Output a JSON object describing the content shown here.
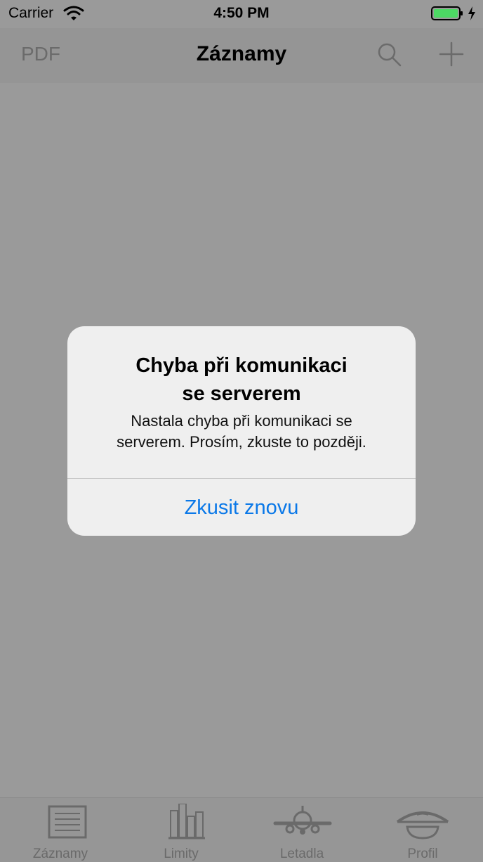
{
  "status_bar": {
    "carrier": "Carrier",
    "time": "4:50 PM",
    "icons": [
      "wifi-icon",
      "battery-icon",
      "charging-bolt-icon"
    ]
  },
  "nav": {
    "left_label": "PDF",
    "title": "Záznamy",
    "right_icons": [
      "search-icon",
      "plus-icon"
    ]
  },
  "alert": {
    "title_line1": "Chyba při komunikaci",
    "title_line2": "se serverem",
    "message_line1": "Nastala chyba při komunikaci se",
    "message_line2": "serverem. Prosím, zkuste to později.",
    "button_label": "Zkusit znovu"
  },
  "tab_bar": {
    "items": [
      {
        "label": "Záznamy",
        "icon": "list-icon"
      },
      {
        "label": "Limity",
        "icon": "bar-chart-icon"
      },
      {
        "label": "Letadla",
        "icon": "airplane-icon"
      },
      {
        "label": "Profil",
        "icon": "pilot-cap-icon"
      }
    ]
  },
  "colors": {
    "dimmed_background": "#9a9a9a",
    "alert_background": "#efefef",
    "alert_button": "#0a78e8",
    "battery_fill": "#4cd964"
  }
}
